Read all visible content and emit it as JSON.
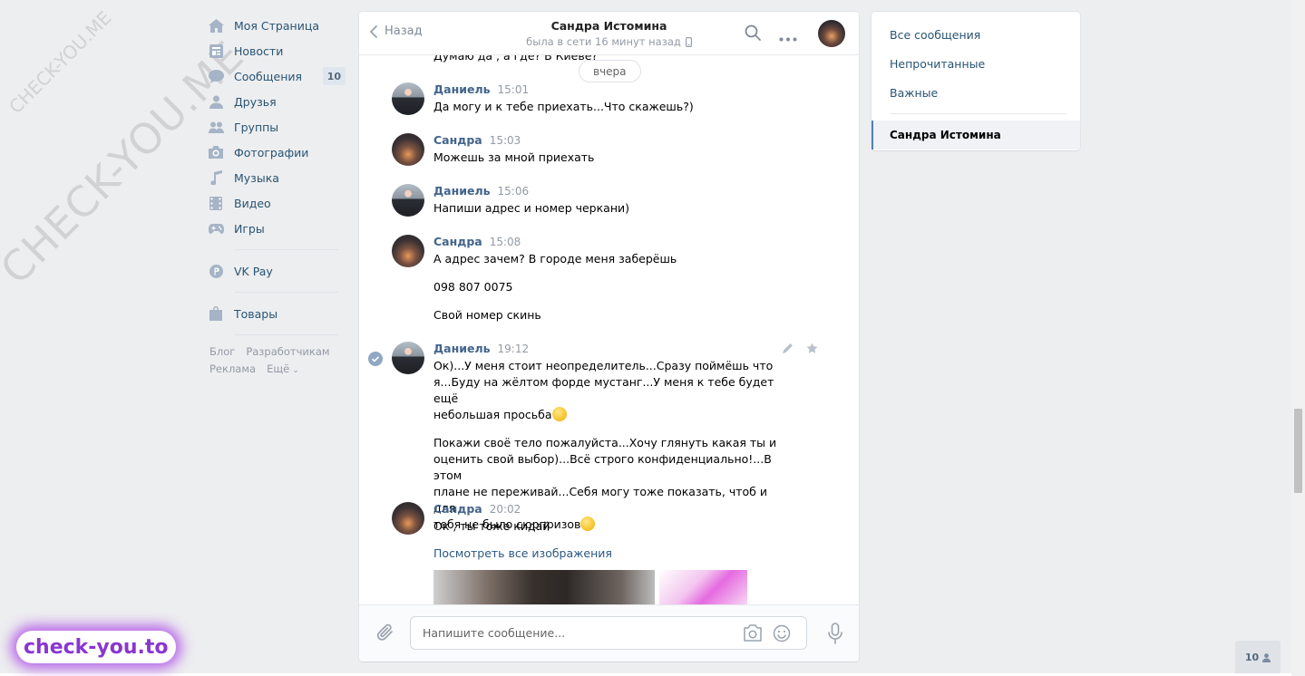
{
  "watermark": {
    "small": "CHECK-YOU.ME",
    "big": "CHECK-YOU.ME",
    "badge": "check-you.to"
  },
  "leftnav": {
    "items": [
      {
        "icon": "home-icon",
        "label": "Моя Страница"
      },
      {
        "icon": "news-icon",
        "label": "Новости"
      },
      {
        "icon": "messages-icon",
        "label": "Сообщения",
        "badge": "10"
      },
      {
        "icon": "friends-icon",
        "label": "Друзья"
      },
      {
        "icon": "groups-icon",
        "label": "Группы"
      },
      {
        "icon": "camera-icon",
        "label": "Фотографии"
      },
      {
        "icon": "music-icon",
        "label": "Музыка"
      },
      {
        "icon": "video-icon",
        "label": "Видео"
      },
      {
        "icon": "gamepad-icon",
        "label": "Игры"
      }
    ],
    "vkpay": {
      "icon": "vkpay-icon",
      "label": "VK Pay"
    },
    "goods": {
      "icon": "bag-icon",
      "label": "Товары"
    },
    "footer": {
      "blog": "Блог",
      "developers": "Разработчикам",
      "ads": "Реклама",
      "more": "Ещё"
    }
  },
  "chat": {
    "back_label": "Назад",
    "contact_name": "Сандра Истомина",
    "contact_status": "была в сети 16 минут назад",
    "day_label": "вчера",
    "top_clipped_text": "Думаю да , а где? В Киеве?",
    "messages": [
      {
        "author": "Даниель",
        "time": "15:01",
        "lines": [
          "Да могу и к тебе приехать...Что скажешь?)"
        ]
      },
      {
        "author": "Сандра",
        "time": "15:03",
        "lines": [
          "Можешь за мной приехать"
        ]
      },
      {
        "author": "Даниель",
        "time": "15:06",
        "lines": [
          "Напиши адрес и номер черкани)"
        ]
      },
      {
        "author": "Сандра",
        "time": "15:08",
        "lines": [
          "А адрес зачем? В городе меня заберёшь",
          "098 807 0075",
          "Свой номер скинь"
        ]
      },
      {
        "author": "Даниель",
        "time": "19:12",
        "p1": [
          "Ок)...У меня стоит неопределитель...Сразу поймёшь что",
          "я...Буду на жёлтом форде мустанг...У меня к тебе будет ещё",
          "небольшая просьба"
        ],
        "p2": [
          "Покажи своё тело пожалуйста...Хочу глянуть какая ты и",
          "оценить свой выбор)...Всё строго конфиденциально!...В этом",
          "плане не переживай...Себя могу тоже показать, чтоб и для",
          "тебя не было сюрпризов"
        ]
      },
      {
        "author": "Сандра",
        "time": "20:02",
        "lines": [
          "Ок , ты тоже кидай"
        ],
        "link": "Посмотреть все изображения"
      }
    ],
    "composer_placeholder": "Напишите сообщение..."
  },
  "filters": {
    "all": "Все сообщения",
    "unread": "Непрочитанные",
    "important": "Важные",
    "active_chat": "Сандра Истомина"
  },
  "online_counter": "10",
  "colors": {
    "accent": "#5181b8",
    "link": "#2a5885",
    "nav_text": "#285473",
    "background": "#edeef0"
  }
}
